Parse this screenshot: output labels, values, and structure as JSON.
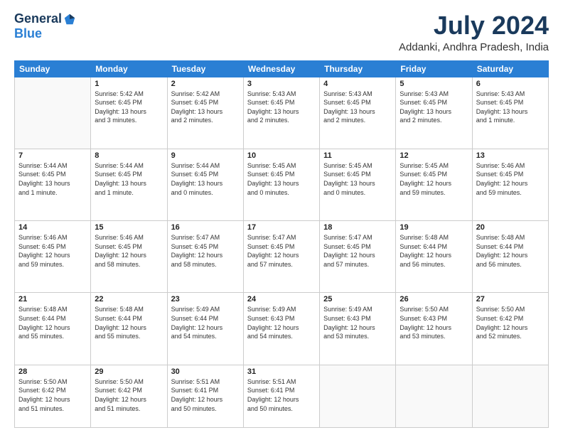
{
  "header": {
    "logo_general": "General",
    "logo_blue": "Blue",
    "month_year": "July 2024",
    "location": "Addanki, Andhra Pradesh, India"
  },
  "days_of_week": [
    "Sunday",
    "Monday",
    "Tuesday",
    "Wednesday",
    "Thursday",
    "Friday",
    "Saturday"
  ],
  "weeks": [
    [
      {
        "day": "",
        "info": ""
      },
      {
        "day": "1",
        "info": "Sunrise: 5:42 AM\nSunset: 6:45 PM\nDaylight: 13 hours\nand 3 minutes."
      },
      {
        "day": "2",
        "info": "Sunrise: 5:42 AM\nSunset: 6:45 PM\nDaylight: 13 hours\nand 2 minutes."
      },
      {
        "day": "3",
        "info": "Sunrise: 5:43 AM\nSunset: 6:45 PM\nDaylight: 13 hours\nand 2 minutes."
      },
      {
        "day": "4",
        "info": "Sunrise: 5:43 AM\nSunset: 6:45 PM\nDaylight: 13 hours\nand 2 minutes."
      },
      {
        "day": "5",
        "info": "Sunrise: 5:43 AM\nSunset: 6:45 PM\nDaylight: 13 hours\nand 2 minutes."
      },
      {
        "day": "6",
        "info": "Sunrise: 5:43 AM\nSunset: 6:45 PM\nDaylight: 13 hours\nand 1 minute."
      }
    ],
    [
      {
        "day": "7",
        "info": "Sunrise: 5:44 AM\nSunset: 6:45 PM\nDaylight: 13 hours\nand 1 minute."
      },
      {
        "day": "8",
        "info": "Sunrise: 5:44 AM\nSunset: 6:45 PM\nDaylight: 13 hours\nand 1 minute."
      },
      {
        "day": "9",
        "info": "Sunrise: 5:44 AM\nSunset: 6:45 PM\nDaylight: 13 hours\nand 0 minutes."
      },
      {
        "day": "10",
        "info": "Sunrise: 5:45 AM\nSunset: 6:45 PM\nDaylight: 13 hours\nand 0 minutes."
      },
      {
        "day": "11",
        "info": "Sunrise: 5:45 AM\nSunset: 6:45 PM\nDaylight: 13 hours\nand 0 minutes."
      },
      {
        "day": "12",
        "info": "Sunrise: 5:45 AM\nSunset: 6:45 PM\nDaylight: 12 hours\nand 59 minutes."
      },
      {
        "day": "13",
        "info": "Sunrise: 5:46 AM\nSunset: 6:45 PM\nDaylight: 12 hours\nand 59 minutes."
      }
    ],
    [
      {
        "day": "14",
        "info": "Sunrise: 5:46 AM\nSunset: 6:45 PM\nDaylight: 12 hours\nand 59 minutes."
      },
      {
        "day": "15",
        "info": "Sunrise: 5:46 AM\nSunset: 6:45 PM\nDaylight: 12 hours\nand 58 minutes."
      },
      {
        "day": "16",
        "info": "Sunrise: 5:47 AM\nSunset: 6:45 PM\nDaylight: 12 hours\nand 58 minutes."
      },
      {
        "day": "17",
        "info": "Sunrise: 5:47 AM\nSunset: 6:45 PM\nDaylight: 12 hours\nand 57 minutes."
      },
      {
        "day": "18",
        "info": "Sunrise: 5:47 AM\nSunset: 6:45 PM\nDaylight: 12 hours\nand 57 minutes."
      },
      {
        "day": "19",
        "info": "Sunrise: 5:48 AM\nSunset: 6:44 PM\nDaylight: 12 hours\nand 56 minutes."
      },
      {
        "day": "20",
        "info": "Sunrise: 5:48 AM\nSunset: 6:44 PM\nDaylight: 12 hours\nand 56 minutes."
      }
    ],
    [
      {
        "day": "21",
        "info": "Sunrise: 5:48 AM\nSunset: 6:44 PM\nDaylight: 12 hours\nand 55 minutes."
      },
      {
        "day": "22",
        "info": "Sunrise: 5:48 AM\nSunset: 6:44 PM\nDaylight: 12 hours\nand 55 minutes."
      },
      {
        "day": "23",
        "info": "Sunrise: 5:49 AM\nSunset: 6:44 PM\nDaylight: 12 hours\nand 54 minutes."
      },
      {
        "day": "24",
        "info": "Sunrise: 5:49 AM\nSunset: 6:43 PM\nDaylight: 12 hours\nand 54 minutes."
      },
      {
        "day": "25",
        "info": "Sunrise: 5:49 AM\nSunset: 6:43 PM\nDaylight: 12 hours\nand 53 minutes."
      },
      {
        "day": "26",
        "info": "Sunrise: 5:50 AM\nSunset: 6:43 PM\nDaylight: 12 hours\nand 53 minutes."
      },
      {
        "day": "27",
        "info": "Sunrise: 5:50 AM\nSunset: 6:42 PM\nDaylight: 12 hours\nand 52 minutes."
      }
    ],
    [
      {
        "day": "28",
        "info": "Sunrise: 5:50 AM\nSunset: 6:42 PM\nDaylight: 12 hours\nand 51 minutes."
      },
      {
        "day": "29",
        "info": "Sunrise: 5:50 AM\nSunset: 6:42 PM\nDaylight: 12 hours\nand 51 minutes."
      },
      {
        "day": "30",
        "info": "Sunrise: 5:51 AM\nSunset: 6:41 PM\nDaylight: 12 hours\nand 50 minutes."
      },
      {
        "day": "31",
        "info": "Sunrise: 5:51 AM\nSunset: 6:41 PM\nDaylight: 12 hours\nand 50 minutes."
      },
      {
        "day": "",
        "info": ""
      },
      {
        "day": "",
        "info": ""
      },
      {
        "day": "",
        "info": ""
      }
    ]
  ]
}
